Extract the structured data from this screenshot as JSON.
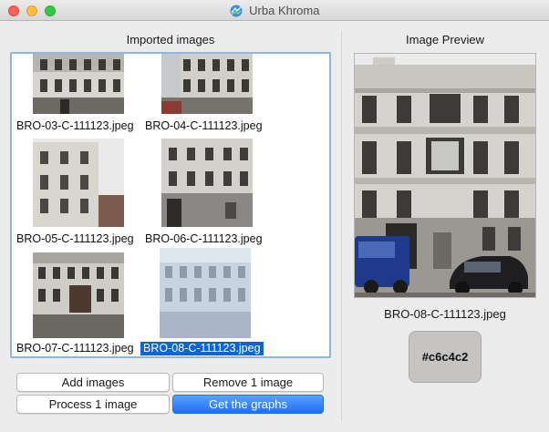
{
  "window": {
    "title": "Urba Khroma"
  },
  "imported_panel": {
    "heading": "Imported images",
    "items": [
      {
        "label": "BRO-03-C-111123.jpeg",
        "selected": false,
        "tone": "#8a8684"
      },
      {
        "label": "BRO-04-C-111123.jpeg",
        "selected": false,
        "tone": "#8e8a84"
      },
      {
        "label": "BRO-05-C-111123.jpeg",
        "selected": false,
        "tone": "#b5b2ad"
      },
      {
        "label": "BRO-06-C-111123.jpeg",
        "selected": false,
        "tone": "#9a9995"
      },
      {
        "label": "BRO-07-C-111123.jpeg",
        "selected": false,
        "tone": "#7d7a78"
      },
      {
        "label": "BRO-08-C-111123.jpeg",
        "selected": true,
        "tone": "#bcc7d4"
      }
    ]
  },
  "buttons": {
    "add_images": "Add images",
    "remove_image": "Remove 1 image",
    "process_image": "Process 1 image",
    "get_graphs": "Get the graphs"
  },
  "preview_panel": {
    "heading": "Image Preview",
    "caption": "BRO-08-C-111123.jpeg",
    "color_hex": "#c6c4c2"
  },
  "colors": {
    "accent": "#1e6ff5",
    "selection": "#0f64d2",
    "list_border": "#8bb6ea"
  }
}
